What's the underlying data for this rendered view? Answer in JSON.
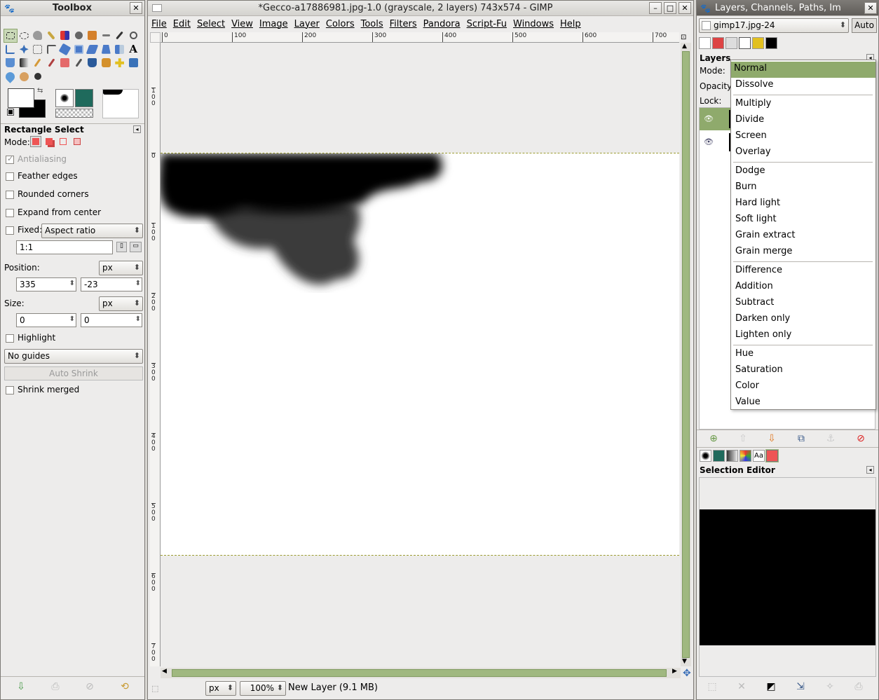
{
  "toolbox": {
    "title": "Toolbox",
    "tool_name": "Rectangle Select",
    "mode_label": "Mode:",
    "antialiasing": "Antialiasing",
    "feather": "Feather edges",
    "rounded": "Rounded corners",
    "expand": "Expand from center",
    "fixed_label": "Fixed:",
    "fixed_value": "Aspect ratio",
    "ratio_value": "1:1",
    "position_label": "Position:",
    "position_unit": "px",
    "pos_x": "335",
    "pos_y": "-23",
    "size_label": "Size:",
    "size_unit": "px",
    "size_w": "0",
    "size_h": "0",
    "highlight": "Highlight",
    "guides": "No guides",
    "auto_shrink": "Auto Shrink",
    "shrink_merged": "Shrink merged"
  },
  "image_window": {
    "title": "*Gecco-a17886981.jpg-1.0 (grayscale, 2 layers) 743x574 - GIMP",
    "menus": [
      "File",
      "Edit",
      "Select",
      "View",
      "Image",
      "Layer",
      "Colors",
      "Tools",
      "Filters",
      "Pandora",
      "Script-Fu",
      "Windows",
      "Help"
    ],
    "hruler": [
      "0",
      "100",
      "200",
      "300",
      "400",
      "500",
      "600",
      "700"
    ],
    "vruler": [
      "1\n0\n0",
      "0",
      "1\n0\n0",
      "2\n0\n0",
      "3\n0\n0",
      "4\n0\n0",
      "5\n0\n0",
      "6\n0\n0",
      "7\n0\n0"
    ],
    "unit": "px",
    "zoom": "100%",
    "status": "New Layer (9.1 MB)"
  },
  "layers_window": {
    "title": "Layers, Channels, Paths, Im",
    "image_select": "gimp17.jpg-24",
    "auto_button": "Auto",
    "section_title": "Layers",
    "mode_label": "Mode:",
    "opacity_label": "Opacity:",
    "lock_label": "Lock:",
    "selection_editor_title": "Selection Editor"
  },
  "mode_dropdown": {
    "groups": [
      [
        "Normal",
        "Dissolve"
      ],
      [
        "Multiply",
        "Divide",
        "Screen",
        "Overlay"
      ],
      [
        "Dodge",
        "Burn",
        "Hard light",
        "Soft light",
        "Grain extract",
        "Grain merge"
      ],
      [
        "Difference",
        "Addition",
        "Subtract",
        "Darken only",
        "Lighten only"
      ],
      [
        "Hue",
        "Saturation",
        "Color",
        "Value"
      ]
    ],
    "selected": "Normal"
  },
  "colors": {
    "accent": "#a0b880",
    "selection_highlight": "#8faa6c"
  }
}
